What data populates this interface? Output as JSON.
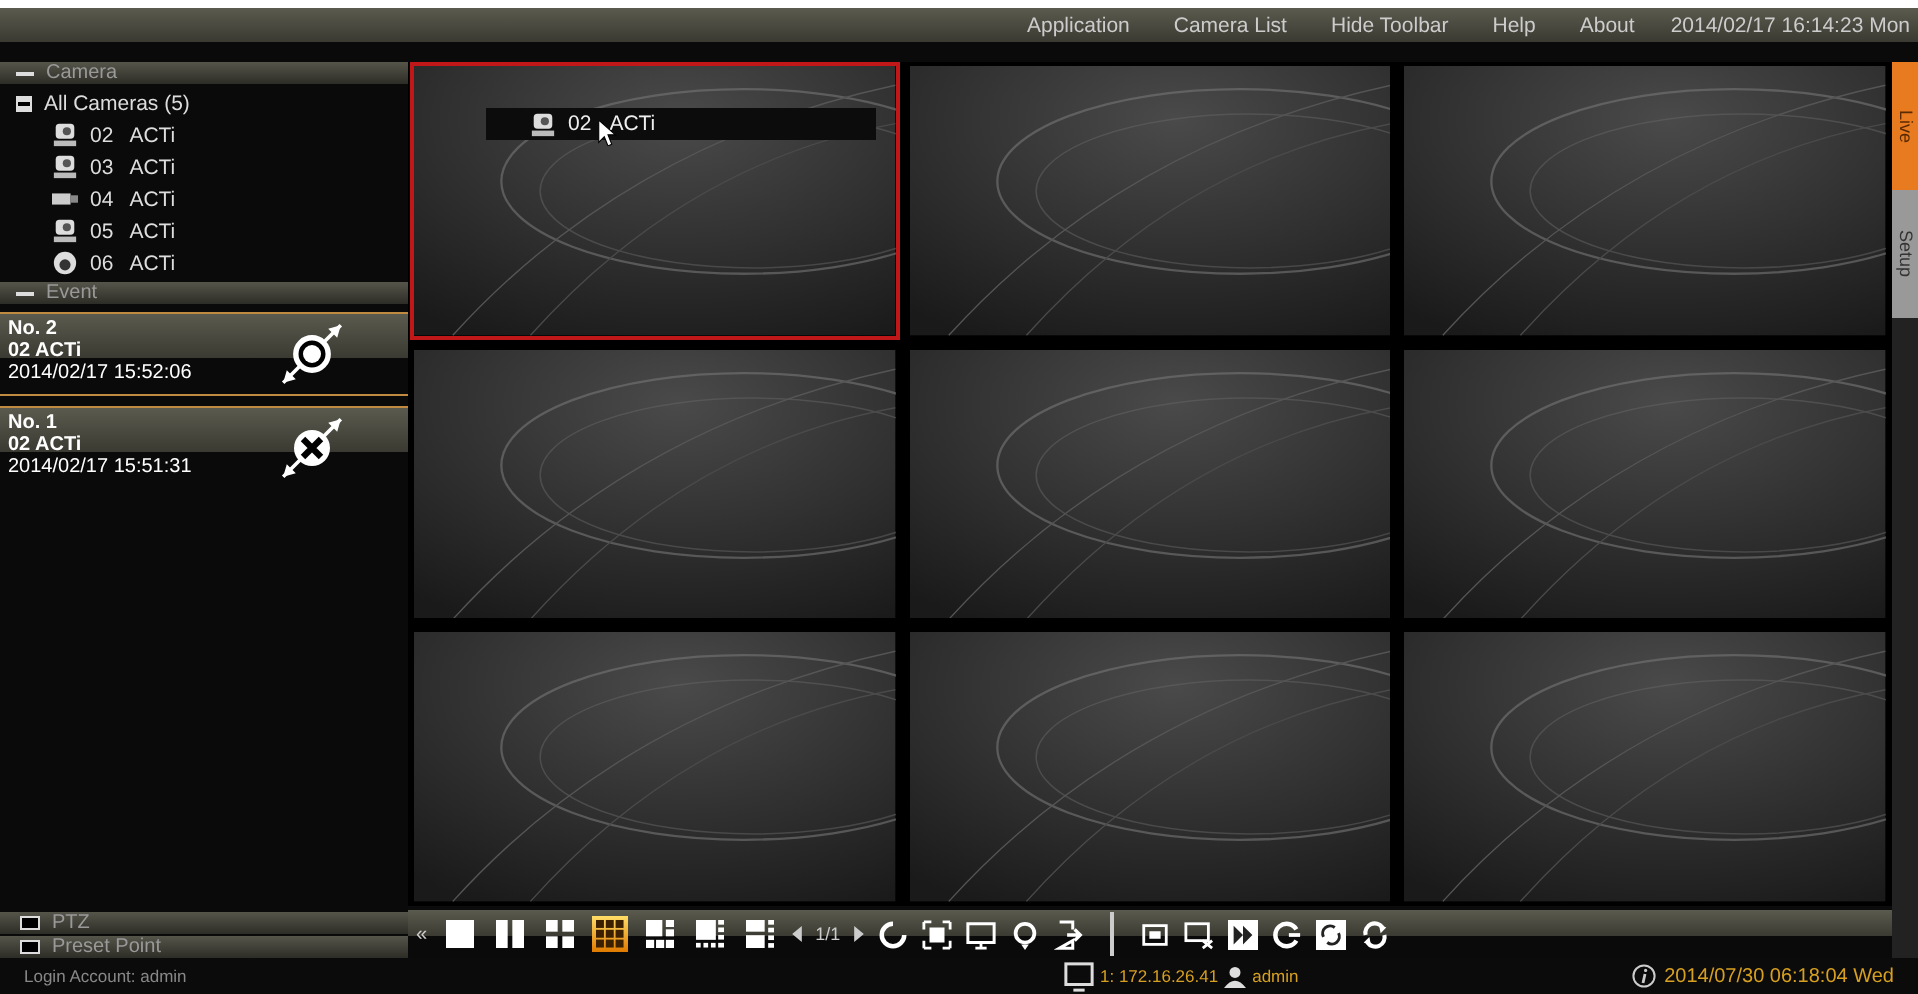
{
  "menu": [
    "Application",
    "Camera List",
    "Hide Toolbar",
    "Help",
    "About"
  ],
  "clock": "2014/02/17 16:14:23 Mon",
  "camera_panel": {
    "title": "Camera",
    "root": {
      "label": "All Cameras (5)",
      "expanded": true,
      "children": [
        {
          "number": "02",
          "name": "ACTi",
          "kind": "ptz"
        },
        {
          "number": "03",
          "name": "ACTi",
          "kind": "ptz"
        },
        {
          "number": "04",
          "name": "ACTi",
          "kind": "box"
        },
        {
          "number": "05",
          "name": "ACTi",
          "kind": "ptz"
        },
        {
          "number": "06",
          "name": "ACTi",
          "kind": "dome"
        }
      ]
    }
  },
  "event_panel": {
    "title": "Event",
    "events": [
      {
        "number": "No. 2",
        "camera": "02 ACTi",
        "time": "2014/02/17 15:52:06",
        "kind": "connected"
      },
      {
        "number": "No. 1",
        "camera": "02 ACTi",
        "time": "2014/02/17 15:51:31",
        "kind": "disconnected"
      }
    ]
  },
  "bottom_panels": [
    "PTZ",
    "Preset Point"
  ],
  "login": "Login Account: admin",
  "side_tabs": [
    {
      "label": "Live",
      "selected": true
    },
    {
      "label": "Setup",
      "selected": false
    }
  ],
  "tiles": [
    {
      "selected": true,
      "overlay": {
        "number": "02",
        "name": "ACTi"
      }
    },
    {
      "selected": false
    },
    {
      "selected": false
    },
    {
      "selected": false
    },
    {
      "selected": false
    },
    {
      "selected": false
    },
    {
      "selected": false
    },
    {
      "selected": false
    },
    {
      "selected": false
    }
  ],
  "toolbar": {
    "collapse": "«",
    "layouts": [
      {
        "kind": "l1",
        "selected": false
      },
      {
        "kind": "l2",
        "selected": false
      },
      {
        "kind": "l4",
        "selected": false
      },
      {
        "kind": "l9",
        "selected": true
      },
      {
        "kind": "l6",
        "selected": false
      },
      {
        "kind": "l8",
        "selected": false
      },
      {
        "kind": "l10",
        "selected": false
      }
    ],
    "page": "1/1"
  },
  "status": {
    "server": "1: 172.16.26.41",
    "user": "admin",
    "time": "2014/07/30 06:18:04 Wed"
  }
}
